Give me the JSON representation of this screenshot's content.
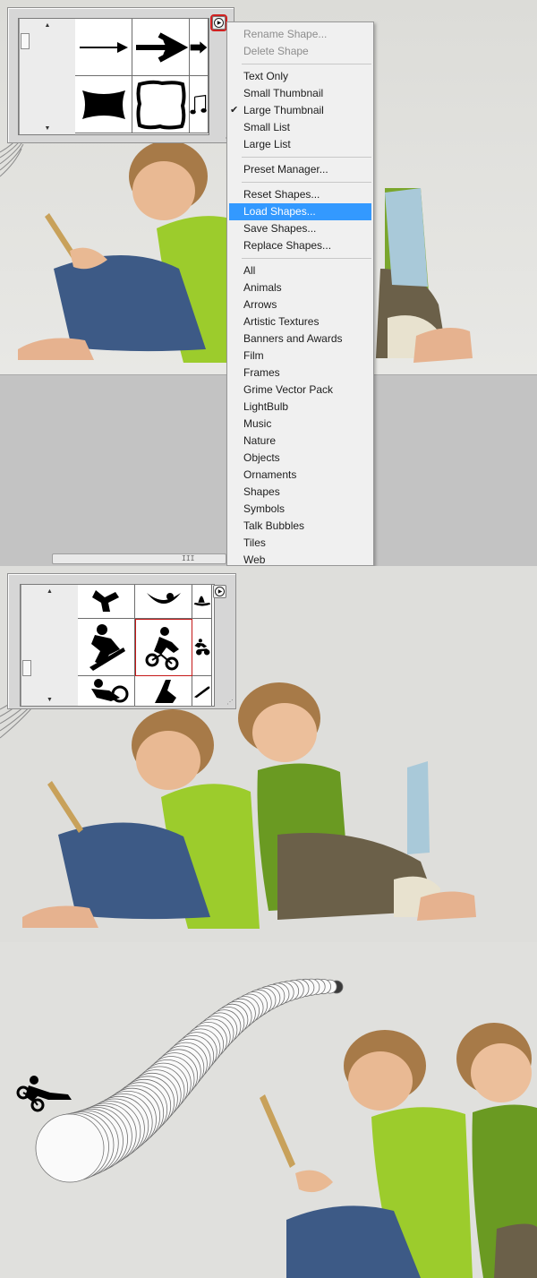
{
  "screenshot_1": {
    "shape_picker": {
      "cell_icons": [
        "thin-arrow-icon",
        "bold-arrow-icon",
        "block-arrow-icon",
        "banner-shape-icon",
        "rough-frame-icon",
        "music-note-icon"
      ]
    },
    "panel_menu_button_icon": "play-circle-icon",
    "panel_menu": {
      "group_shape_edit": [
        {
          "label": "Rename Shape...",
          "enabled": false
        },
        {
          "label": "Delete Shape",
          "enabled": false
        }
      ],
      "group_view": [
        {
          "label": "Text Only",
          "checked": false
        },
        {
          "label": "Small Thumbnail",
          "checked": false
        },
        {
          "label": "Large Thumbnail",
          "checked": true
        },
        {
          "label": "Small List",
          "checked": false
        },
        {
          "label": "Large List",
          "checked": false
        }
      ],
      "preset_manager": "Preset Manager...",
      "group_shapes_io": [
        {
          "label": "Reset Shapes...",
          "highlighted": false
        },
        {
          "label": "Load Shapes...",
          "highlighted": true
        },
        {
          "label": "Save Shapes...",
          "highlighted": false
        },
        {
          "label": "Replace Shapes...",
          "highlighted": false
        }
      ],
      "group_libraries": [
        "All",
        "Animals",
        "Arrows",
        "Artistic Textures",
        "Banners and Awards",
        "Film",
        "Frames",
        "Grime Vector Pack",
        "LightBulb",
        "Music",
        "Nature",
        "Objects",
        "Ornaments",
        "Shapes",
        "Symbols",
        "Talk Bubbles",
        "Tiles",
        "Web"
      ],
      "highlight_color": "#3399ff"
    },
    "scrollbar_grip": "III"
  },
  "screenshot_2": {
    "shape_picker": {
      "cell_icons": [
        "skydiver-icon",
        "skateboarder-icon",
        "snowboard-icon",
        "snowboarder-icon",
        "bmx-rider-icon",
        "dirtbike-rider-icon",
        "biker-icon",
        "jumper-icon",
        "board-icon"
      ],
      "selected_index": 4
    }
  },
  "screenshot_3": {
    "stamped_shape_icon": "bmx-rider-icon"
  },
  "colors": {
    "selected_outline": "#c41818",
    "shirt_lime": "#9ccc2c",
    "shirt_olive": "#6a9a22",
    "jeans": "#3d5a86"
  }
}
